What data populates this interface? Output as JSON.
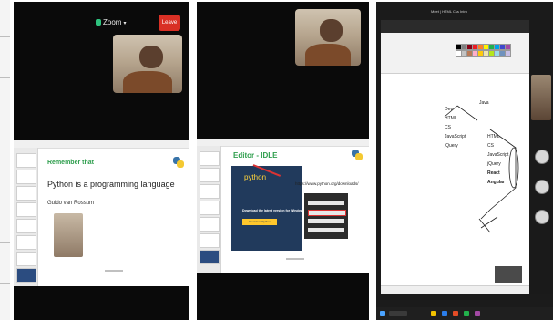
{
  "panel1": {
    "app_title": "Zoom",
    "leave_button": "Leave",
    "slide": {
      "heading": "Remember that",
      "statement": "Python is a programming language",
      "author": "Guido van Rossum"
    }
  },
  "panel2": {
    "slide": {
      "heading": "Editor - IDLE",
      "python_logo_text": "python",
      "url_text": "https://www.python.org/downloads/",
      "download_text": "Download the latest version for Windows",
      "download_button": "Download Python"
    }
  },
  "panel3": {
    "window_title": "Meet | HTML Css Intro",
    "left_tree": [
      "Dev",
      "HTML",
      "CS",
      "JavaScript",
      "jQuery"
    ],
    "right_tree": [
      "HTML",
      "CS",
      "JavaScript",
      "jQuery",
      "React",
      "Angular"
    ],
    "tree_root": "Java",
    "ribbon_colors": [
      "#000000",
      "#7f7f7f",
      "#880015",
      "#ed1c24",
      "#ff7f27",
      "#fff200",
      "#22b14c",
      "#00a2e8",
      "#3f48cc",
      "#a349a4",
      "#ffffff",
      "#c3c3c3",
      "#b97a57",
      "#ffaec9",
      "#ffc90e",
      "#efe4b0",
      "#b5e61d",
      "#99d9ea",
      "#7092be",
      "#c8bfe7"
    ]
  },
  "colors": {
    "zoom_black": "#0a0a0a",
    "leave_red": "#d93025",
    "slide_green": "#2e9e4d",
    "python_blue": "#3873a8",
    "python_yellow": "#f4c932"
  }
}
